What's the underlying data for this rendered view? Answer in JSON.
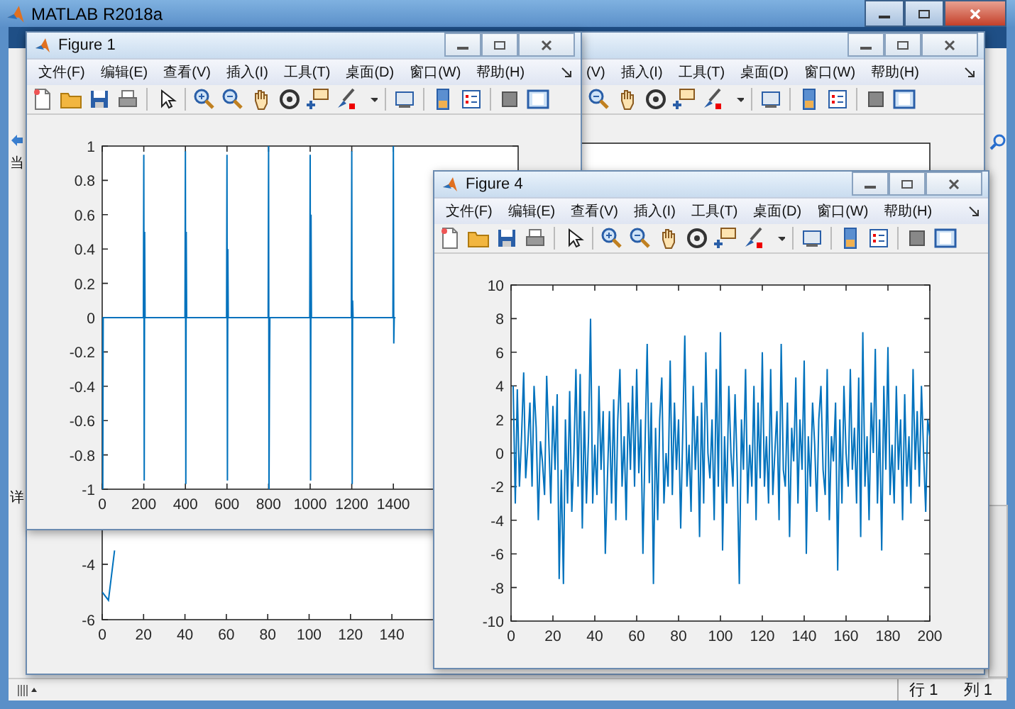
{
  "window": {
    "title": "MATLAB R2018a"
  },
  "left_strip": {
    "labels": [
      "当",
      "详"
    ]
  },
  "status_bar": {
    "row": "行 1",
    "column": "列 1"
  },
  "background_figure": {
    "menu": [
      "(V)",
      "插入(I)",
      "工具(T)",
      "桌面(D)",
      "窗口(W)",
      "帮助(H)"
    ],
    "chart_data": {
      "type": "line",
      "xlim": [
        0,
        400
      ],
      "ylim": [
        -6,
        11.2
      ],
      "xticks": [
        0,
        20,
        40,
        60,
        80,
        100,
        120,
        140
      ],
      "yticks": [
        -4,
        -6
      ],
      "x": [
        0,
        3,
        6
      ],
      "series": [
        {
          "color": "#0072bd",
          "values": [
            -5,
            -5.3,
            -3.5
          ]
        }
      ]
    }
  },
  "figure_1": {
    "title": "Figure 1",
    "menu": [
      "文件(F)",
      "编辑(E)",
      "查看(V)",
      "插入(I)",
      "工具(T)",
      "桌面(D)",
      "窗口(W)",
      "帮助(H)"
    ],
    "chart_data": {
      "type": "line",
      "xlim": [
        0,
        2000
      ],
      "ylim": [
        -1,
        1
      ],
      "xticks": [
        0,
        200,
        400,
        600,
        800,
        1000,
        1200,
        1400
      ],
      "yticks": [
        1,
        0.8,
        0.6,
        0.4,
        0.2,
        0,
        -0.2,
        -0.4,
        -0.6,
        -0.8,
        -1
      ],
      "x": [
        0,
        1,
        3,
        5,
        198,
        200,
        202,
        204,
        206,
        398,
        400,
        402,
        404,
        406,
        598,
        600,
        602,
        604,
        606,
        798,
        800,
        802,
        804,
        806,
        998,
        1000,
        1002,
        1004,
        1006,
        1198,
        1200,
        1202,
        1204,
        1206,
        1398,
        1400,
        1402,
        1404,
        1410
      ],
      "series": [
        {
          "color": "#0072bd",
          "values": [
            0,
            -0.85,
            -1,
            0,
            0,
            0.95,
            -0.95,
            0.5,
            0,
            0,
            0.97,
            -0.97,
            0.5,
            0,
            0,
            0.95,
            -0.95,
            0.4,
            0,
            0,
            1,
            -1,
            -0.4,
            0,
            0,
            0.95,
            -0.95,
            0.6,
            0,
            0,
            0.97,
            -0.97,
            0.1,
            0,
            0,
            1,
            -0.15,
            0,
            0
          ]
        }
      ]
    }
  },
  "figure_4": {
    "title": "Figure 4",
    "menu": [
      "文件(F)",
      "编辑(E)",
      "查看(V)",
      "插入(I)",
      "工具(T)",
      "桌面(D)",
      "窗口(W)",
      "帮助(H)"
    ],
    "chart_data": {
      "type": "line",
      "xlim": [
        0,
        200
      ],
      "ylim": [
        -10,
        10
      ],
      "xticks": [
        0,
        20,
        40,
        60,
        80,
        100,
        120,
        140,
        160,
        180,
        200
      ],
      "yticks": [
        10,
        8,
        6,
        4,
        2,
        0,
        -2,
        -4,
        -6,
        -8,
        -10
      ],
      "x": [
        1,
        2,
        3,
        4,
        5,
        6,
        7,
        8,
        9,
        10,
        11,
        12,
        13,
        14,
        15,
        16,
        17,
        18,
        19,
        20,
        21,
        22,
        23,
        24,
        25,
        26,
        27,
        28,
        29,
        30,
        31,
        32,
        33,
        34,
        35,
        36,
        37,
        38,
        39,
        40,
        41,
        42,
        43,
        44,
        45,
        46,
        47,
        48,
        49,
        50,
        51,
        52,
        53,
        54,
        55,
        56,
        57,
        58,
        59,
        60,
        61,
        62,
        63,
        64,
        65,
        66,
        67,
        68,
        69,
        70,
        71,
        72,
        73,
        74,
        75,
        76,
        77,
        78,
        79,
        80,
        81,
        82,
        83,
        84,
        85,
        86,
        87,
        88,
        89,
        90,
        91,
        92,
        93,
        94,
        95,
        96,
        97,
        98,
        99,
        100,
        101,
        102,
        103,
        104,
        105,
        106,
        107,
        108,
        109,
        110,
        111,
        112,
        113,
        114,
        115,
        116,
        117,
        118,
        119,
        120,
        121,
        122,
        123,
        124,
        125,
        126,
        127,
        128,
        129,
        130,
        131,
        132,
        133,
        134,
        135,
        136,
        137,
        138,
        139,
        140,
        141,
        142,
        143,
        144,
        145,
        146,
        147,
        148,
        149,
        150,
        151,
        152,
        153,
        154,
        155,
        156,
        157,
        158,
        159,
        160,
        161,
        162,
        163,
        164,
        165,
        166,
        167,
        168,
        169,
        170,
        171,
        172,
        173,
        174,
        175,
        176,
        177,
        178,
        179,
        180,
        181,
        182,
        183,
        184,
        185,
        186,
        187,
        188,
        189,
        190,
        191,
        192,
        193,
        194,
        195,
        196,
        197,
        198,
        199,
        200
      ],
      "series": [
        {
          "color": "#0072bd",
          "values": [
            4,
            -3,
            3.8,
            -2,
            1,
            4.8,
            -1.5,
            0.5,
            3,
            -2,
            4,
            1.5,
            -4,
            0.7,
            -0.5,
            -2.5,
            4.6,
            1,
            -3,
            2.8,
            -1,
            3.5,
            -7.5,
            -1,
            -7.8,
            2,
            -3,
            3.7,
            -3.5,
            0,
            5,
            -2,
            4.7,
            -4.5,
            2.5,
            -3,
            1,
            8,
            -3,
            0.5,
            -2.5,
            4,
            -1,
            2.5,
            -6,
            -1.5,
            2.5,
            -3,
            3.2,
            -4,
            2,
            5,
            -2,
            1,
            -4,
            3,
            -1,
            4,
            -2,
            5,
            -1.2,
            2,
            -6,
            0.5,
            6.5,
            -1.8,
            3,
            -7.8,
            1.5,
            -4,
            2,
            4.5,
            -3,
            0,
            -2,
            5.5,
            -2.5,
            3,
            -1,
            2,
            -4.5,
            1,
            7,
            -2,
            0.5,
            -3.5,
            4,
            -1,
            2.2,
            -5,
            3,
            -3,
            6,
            0,
            -1.5,
            2,
            -4,
            5,
            -2,
            7.2,
            -5.8,
            1,
            -3,
            4,
            0,
            -2,
            3.5,
            -1,
            -7.8,
            2,
            -1,
            5,
            -3,
            0.5,
            -2,
            4,
            -4,
            3,
            -1.5,
            6,
            -2,
            1,
            -3,
            5,
            -2.5,
            0,
            2.5,
            -4,
            6.5,
            -1,
            -2,
            3,
            -5,
            1.5,
            -0.5,
            4.5,
            -3,
            2,
            -1,
            5.5,
            -6,
            1,
            -2,
            3,
            0.5,
            -3.5,
            2,
            4,
            -1,
            -2.5,
            5,
            -4,
            1,
            -0.5,
            3,
            -7,
            2,
            -3,
            4,
            0,
            -2,
            5,
            -1,
            1.5,
            -3,
            4.5,
            -5,
            7.2,
            -2,
            1,
            -4,
            3,
            0,
            6.2,
            -3,
            2,
            -5.8,
            4,
            -1,
            6.3,
            -2.5,
            0.5,
            -3,
            4,
            -1,
            2,
            -4,
            3.5,
            -2,
            1,
            -3,
            5,
            -1,
            2.5,
            -2,
            4,
            0,
            -3.5,
            2,
            1
          ]
        }
      ]
    }
  }
}
